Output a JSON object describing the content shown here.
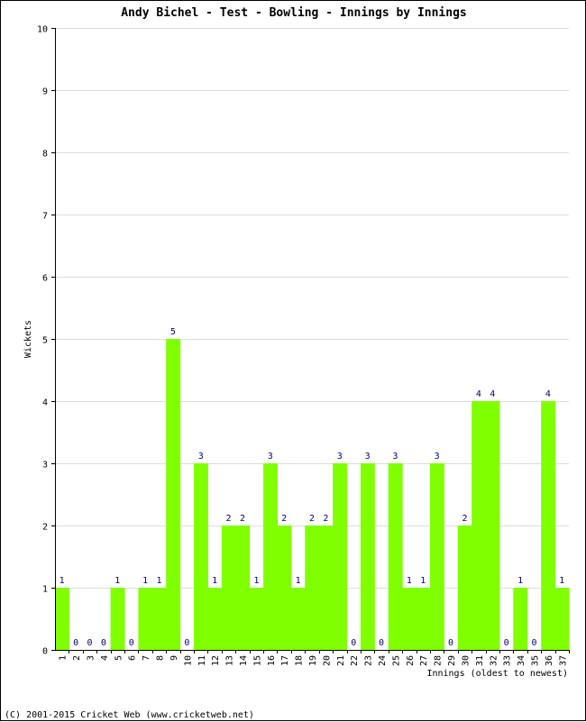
{
  "chart_data": {
    "type": "bar",
    "title": "Andy Bichel - Test - Bowling - Innings by Innings",
    "xlabel": "Innings (oldest to newest)",
    "ylabel": "Wickets",
    "ylim": [
      0,
      10
    ],
    "yticks": [
      0,
      1,
      2,
      3,
      4,
      5,
      6,
      7,
      8,
      9,
      10
    ],
    "grid": true,
    "bar_color": "#80ff00",
    "label_color": "#000080",
    "grid_color": "#dddddd",
    "categories": [
      "1",
      "2",
      "3",
      "4",
      "5",
      "6",
      "7",
      "8",
      "9",
      "10",
      "11",
      "12",
      "13",
      "14",
      "15",
      "16",
      "17",
      "18",
      "19",
      "20",
      "21",
      "22",
      "23",
      "24",
      "25",
      "26",
      "27",
      "28",
      "29",
      "30",
      "31",
      "32",
      "33",
      "34",
      "35",
      "36",
      "37"
    ],
    "values": [
      1,
      0,
      0,
      0,
      1,
      0,
      1,
      1,
      5,
      0,
      3,
      1,
      2,
      2,
      1,
      3,
      2,
      1,
      2,
      2,
      3,
      0,
      3,
      0,
      3,
      1,
      1,
      3,
      0,
      2,
      4,
      4,
      0,
      1,
      0,
      4,
      1
    ]
  },
  "footer": "(C) 2001-2015 Cricket Web (www.cricketweb.net)"
}
